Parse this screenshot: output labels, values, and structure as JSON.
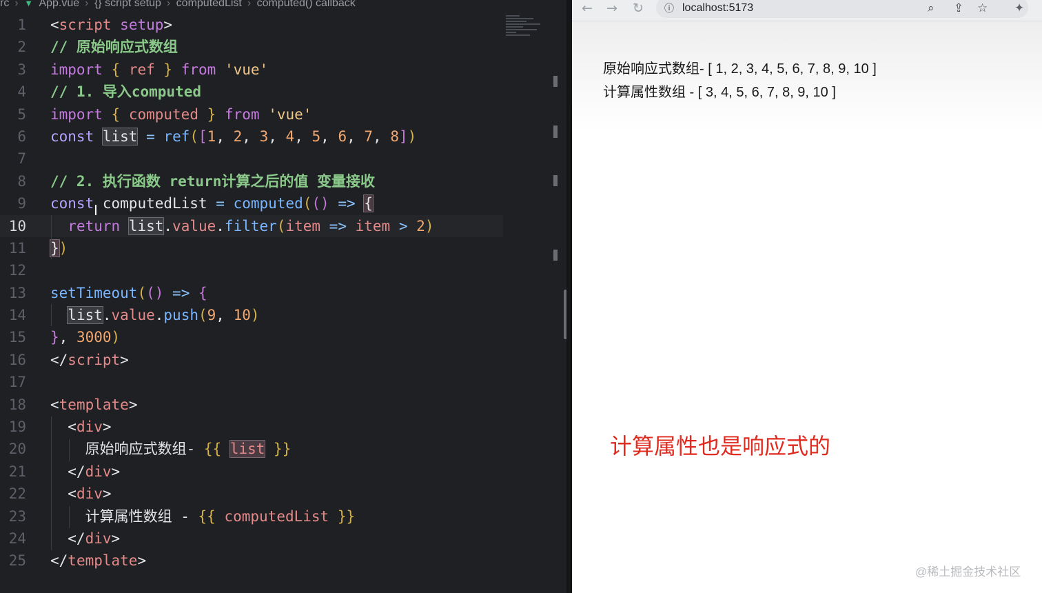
{
  "breadcrumb": {
    "items": [
      "rc",
      "App.vue",
      "{} script setup",
      "computedList",
      "computed() callback"
    ]
  },
  "editor": {
    "active_line": "10",
    "line_numbers": [
      "1",
      "2",
      "3",
      "4",
      "5",
      "6",
      "7",
      "8",
      "9",
      "10",
      "11",
      "12",
      "13",
      "14",
      "15",
      "16",
      "17",
      "18",
      "19",
      "20",
      "21",
      "22",
      "23",
      "24",
      "25"
    ]
  },
  "browser": {
    "url": "localhost:5173",
    "line1": "原始响应式数组- [ 1, 2, 3, 4, 5, 6, 7, 8, 9, 10 ]",
    "line2": "计算属性数组 - [ 3, 4, 5, 6, 7, 8, 9, 10 ]"
  },
  "annotation": "计算属性也是响应式的",
  "watermark": "@稀土掘金技术社区",
  "colors": {
    "editor_bg": "#1f2023",
    "keyword": "#c57be0",
    "comment": "#8ac98a",
    "string": "#f0c68b",
    "number": "#f2a870",
    "function": "#7ab6ff",
    "annotation_red": "#e02b20"
  },
  "icons": {
    "back": "arrow-left-icon",
    "forward": "arrow-right-icon",
    "reload": "reload-icon",
    "info": "info-icon",
    "zoom": "zoom-icon",
    "share": "share-icon",
    "bookmark": "star-icon",
    "extensions": "puzzle-icon"
  }
}
